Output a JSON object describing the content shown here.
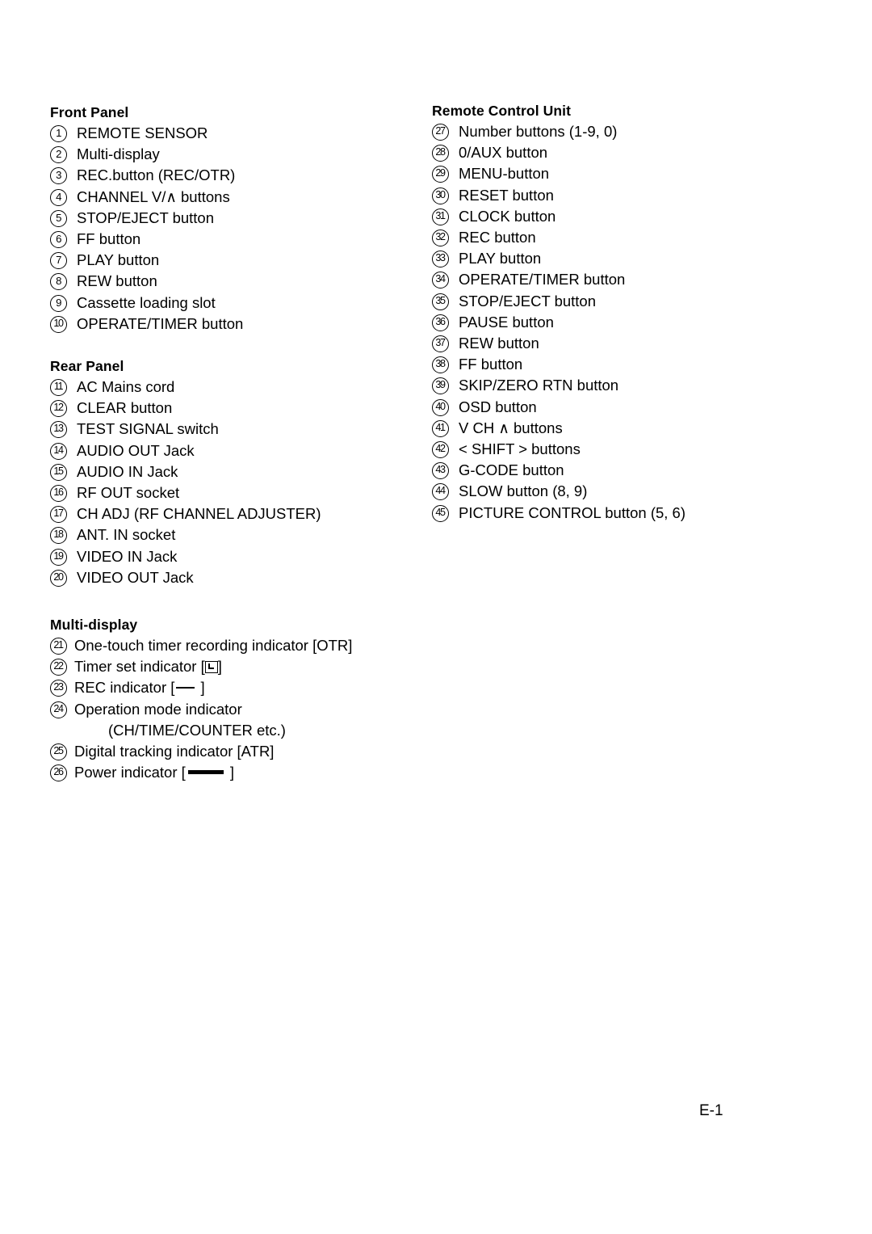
{
  "page": {
    "footer_label": "E-1"
  },
  "left_column": {
    "sections": [
      {
        "heading": "Front Panel",
        "items": [
          {
            "num": "1",
            "label": "REMOTE SENSOR"
          },
          {
            "num": "2",
            "label": "Multi-display"
          },
          {
            "num": "3",
            "label": "REC.button (REC/OTR)"
          },
          {
            "num": "4",
            "label": "CHANNEL V/∧ buttons"
          },
          {
            "num": "5",
            "label": "STOP/EJECT button"
          },
          {
            "num": "6",
            "label": "FF button"
          },
          {
            "num": "7",
            "label": "PLAY button"
          },
          {
            "num": "8",
            "label": "REW button"
          },
          {
            "num": "9",
            "label": "Cassette loading slot"
          },
          {
            "num": "10",
            "label": "OPERATE/TIMER button"
          }
        ]
      },
      {
        "heading": "Rear Panel",
        "items": [
          {
            "num": "11",
            "label": "AC Mains cord"
          },
          {
            "num": "12",
            "label": "CLEAR button"
          },
          {
            "num": "13",
            "label": "TEST SIGNAL switch"
          },
          {
            "num": "14",
            "label": "AUDIO OUT Jack"
          },
          {
            "num": "15",
            "label": "AUDIO IN Jack"
          },
          {
            "num": "16",
            "label": "RF OUT socket"
          },
          {
            "num": "17",
            "label": "CH ADJ (RF CHANNEL ADJUSTER)"
          },
          {
            "num": "18",
            "label": "ANT. IN socket"
          },
          {
            "num": "19",
            "label": "VIDEO IN Jack"
          },
          {
            "num": "20",
            "label": "VIDEO OUT Jack"
          }
        ]
      },
      {
        "heading": "Multi-display",
        "items": [
          {
            "num": "21",
            "label": "One-touch timer recording indicator [OTR]"
          },
          {
            "num": "22",
            "label_before": "Timer set indicator [",
            "glyph": "timer-set-icon",
            "label_after": "]"
          },
          {
            "num": "23",
            "label_before": "REC indicator [",
            "glyph": "rec-dash-icon",
            "label_after": " ]"
          },
          {
            "num": "24",
            "label": "Operation mode indicator",
            "continuation": "(CH/TIME/COUNTER etc.)"
          },
          {
            "num": "25",
            "label": "Digital tracking indicator [ATR]"
          },
          {
            "num": "26",
            "label_before": "Power indicator [",
            "glyph": "power-bar-icon",
            "label_after": " ]"
          }
        ]
      }
    ]
  },
  "right_column": {
    "sections": [
      {
        "heading": "Remote Control Unit",
        "items": [
          {
            "num": "27",
            "label": "Number buttons (1-9, 0)"
          },
          {
            "num": "28",
            "label": "0/AUX button"
          },
          {
            "num": "29",
            "label": "MENU-button"
          },
          {
            "num": "30",
            "label": "RESET button"
          },
          {
            "num": "31",
            "label": "CLOCK button"
          },
          {
            "num": "32",
            "label": "REC button"
          },
          {
            "num": "33",
            "label": "PLAY button"
          },
          {
            "num": "34",
            "label": "OPERATE/TIMER button"
          },
          {
            "num": "35",
            "label": "STOP/EJECT button"
          },
          {
            "num": "36",
            "label": "PAUSE button"
          },
          {
            "num": "37",
            "label": "REW button"
          },
          {
            "num": "38",
            "label": "FF button"
          },
          {
            "num": "39",
            "label": "SKIP/ZERO RTN button"
          },
          {
            "num": "40",
            "label": "OSD button"
          },
          {
            "num": "41",
            "label": " V CH ∧  buttons"
          },
          {
            "num": "42",
            "label": " < SHIFT > buttons"
          },
          {
            "num": "43",
            "label": "G-CODE button"
          },
          {
            "num": "44",
            "label": "SLOW button (8, 9)"
          },
          {
            "num": "45",
            "label": " PICTURE CONTROL button (5, 6)"
          }
        ]
      }
    ]
  }
}
